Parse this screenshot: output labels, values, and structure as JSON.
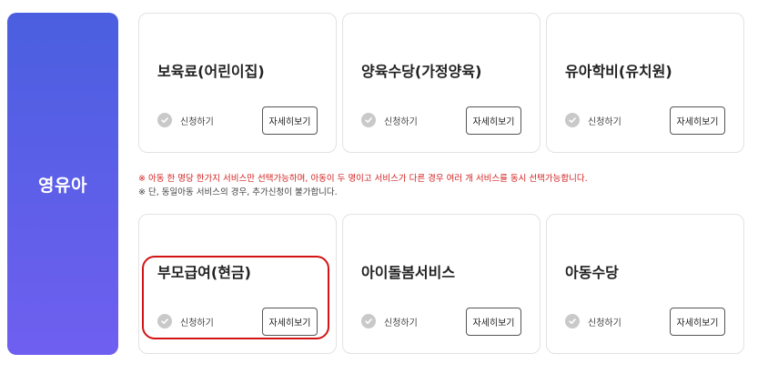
{
  "category": {
    "title": "영유아"
  },
  "cards": [
    {
      "title": "보육료(어린이집)",
      "apply_label": "신청하기",
      "detail_label": "자세히보기"
    },
    {
      "title": "양육수당(가정양육)",
      "apply_label": "신청하기",
      "detail_label": "자세히보기"
    },
    {
      "title": "유아학비(유치원)",
      "apply_label": "신청하기",
      "detail_label": "자세히보기"
    },
    {
      "title": "부모급여(현금)",
      "apply_label": "신청하기",
      "detail_label": "자세히보기"
    },
    {
      "title": "아이돌봄서비스",
      "apply_label": "신청하기",
      "detail_label": "자세히보기"
    },
    {
      "title": "아동수당",
      "apply_label": "신청하기",
      "detail_label": "자세히보기"
    }
  ],
  "notes": {
    "line1": "※ 아동 한 명당 한가지 서비스만 선택가능하며, 아동이 두 명이고 서비스가 다른 경우 여러 개 서비스를 동시 선택가능합니다.",
    "line2": "※ 단, 동일아동 서비스의 경우, 추가신청이 불가합니다."
  },
  "colors": {
    "panel_gradient_top": "#4a5fe0",
    "panel_gradient_bottom": "#6f5ff0",
    "note_red": "#d21f1f",
    "highlight_ring": "#d21414",
    "check_icon_gray": "#c9c9c9"
  },
  "icons": {
    "apply": "check-circle-icon"
  }
}
